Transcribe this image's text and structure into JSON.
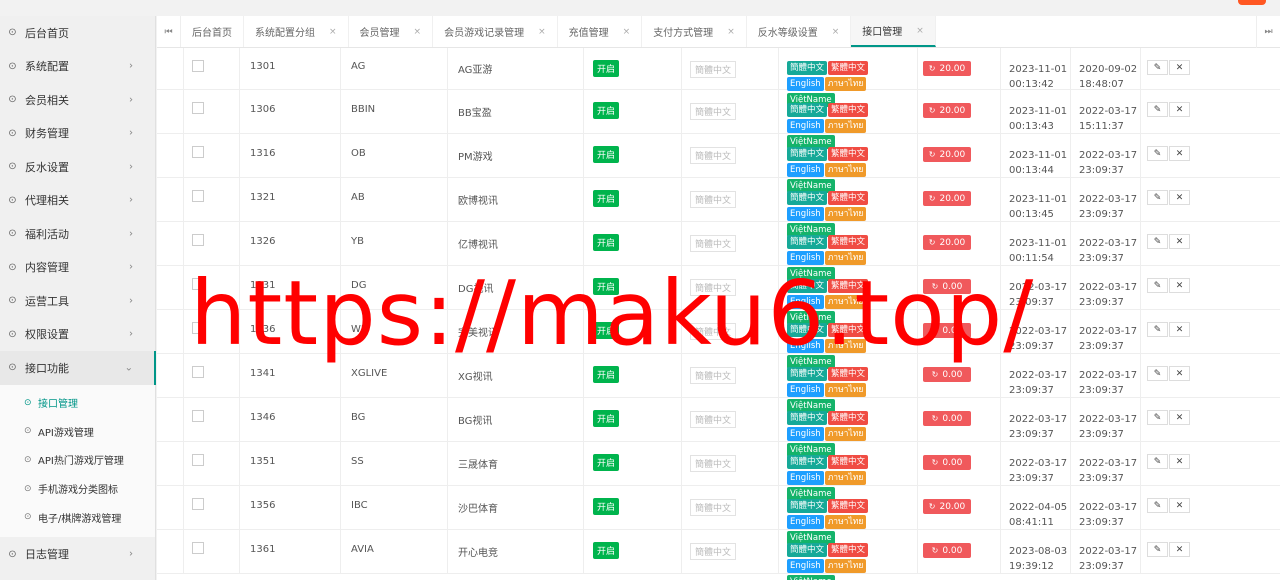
{
  "sidebar": {
    "items": [
      {
        "label": "后台首页",
        "icon": "leaf-icon",
        "has_arrow": false
      },
      {
        "label": "系统配置",
        "icon": "leaf-icon",
        "has_arrow": true
      },
      {
        "label": "会员相关",
        "icon": "leaf-icon",
        "has_arrow": true
      },
      {
        "label": "财务管理",
        "icon": "leaf-icon",
        "has_arrow": true
      },
      {
        "label": "反水设置",
        "icon": "leaf-icon",
        "has_arrow": true
      },
      {
        "label": "代理相关",
        "icon": "leaf-icon",
        "has_arrow": true
      },
      {
        "label": "福利活动",
        "icon": "leaf-icon",
        "has_arrow": true
      },
      {
        "label": "内容管理",
        "icon": "leaf-icon",
        "has_arrow": true
      },
      {
        "label": "运营工具",
        "icon": "leaf-icon",
        "has_arrow": true
      },
      {
        "label": "权限设置",
        "icon": "leaf-icon",
        "has_arrow": true
      },
      {
        "label": "接口功能",
        "icon": "leaf-icon",
        "has_arrow": true,
        "open": true
      }
    ],
    "sub_items": [
      {
        "label": "接口管理",
        "active": true
      },
      {
        "label": "API游戏管理"
      },
      {
        "label": "API热门游戏厅管理"
      },
      {
        "label": "手机游戏分类图标"
      },
      {
        "label": "电子/棋牌游戏管理"
      }
    ],
    "last_item": {
      "label": "日志管理"
    }
  },
  "tabs": {
    "items": [
      {
        "label": "后台首页",
        "closable": false
      },
      {
        "label": "系统配置分组",
        "closable": true
      },
      {
        "label": "会员管理",
        "closable": true
      },
      {
        "label": "会员游戏记录管理",
        "closable": true
      },
      {
        "label": "充值管理",
        "closable": true
      },
      {
        "label": "支付方式管理",
        "closable": true
      },
      {
        "label": "反水等级设置",
        "closable": true
      },
      {
        "label": "接口管理",
        "closable": true,
        "active": true
      }
    ],
    "close_glyph": "×",
    "prev_glyph": "⏮",
    "next_glyph": "⏭"
  },
  "table": {
    "status_label": "开启",
    "lang_simplified": "簡體中文",
    "lang_traditional": "繁體中文",
    "lang_english": "English",
    "lang_thai": "ภาษาไทย",
    "lang_viet": "ViệtName",
    "edit_glyph": "✎",
    "delete_glyph": "✕",
    "refresh_glyph": "↻",
    "rows": [
      {
        "id": "1301",
        "code": "AG",
        "name": "AG亚游",
        "amount": "20.00",
        "created": "2023-11-01",
        "created_time": "00:13:42",
        "updated": "2020-09-02",
        "updated_time": "18:48:07"
      },
      {
        "id": "1306",
        "code": "BBIN",
        "name": "BB宝盈",
        "amount": "20.00",
        "created": "2023-11-01",
        "created_time": "00:13:43",
        "updated": "2022-03-17",
        "updated_time": "15:11:37"
      },
      {
        "id": "1316",
        "code": "OB",
        "name": "PM游戏",
        "amount": "20.00",
        "created": "2023-11-01",
        "created_time": "00:13:44",
        "updated": "2022-03-17",
        "updated_time": "23:09:37"
      },
      {
        "id": "1321",
        "code": "AB",
        "name": "欧博视讯",
        "amount": "20.00",
        "created": "2023-11-01",
        "created_time": "00:13:45",
        "updated": "2022-03-17",
        "updated_time": "23:09:37"
      },
      {
        "id": "1326",
        "code": "YB",
        "name": "亿博视讯",
        "amount": "20.00",
        "created": "2023-11-01",
        "created_time": "00:11:54",
        "updated": "2022-03-17",
        "updated_time": "23:09:37"
      },
      {
        "id": "1331",
        "code": "DG",
        "name": "DG视讯",
        "amount": "0.00",
        "created": "2022-03-17",
        "created_time": "23:09:37",
        "updated": "2022-03-17",
        "updated_time": "23:09:37"
      },
      {
        "id": "1336",
        "code": "WM",
        "name": "完美视讯",
        "amount": "0.00",
        "created": "2022-03-17",
        "created_time": "23:09:37",
        "updated": "2022-03-17",
        "updated_time": "23:09:37"
      },
      {
        "id": "1341",
        "code": "XGLIVE",
        "name": "XG视讯",
        "amount": "0.00",
        "created": "2022-03-17",
        "created_time": "23:09:37",
        "updated": "2022-03-17",
        "updated_time": "23:09:37"
      },
      {
        "id": "1346",
        "code": "BG",
        "name": "BG视讯",
        "amount": "0.00",
        "created": "2022-03-17",
        "created_time": "23:09:37",
        "updated": "2022-03-17",
        "updated_time": "23:09:37"
      },
      {
        "id": "1351",
        "code": "SS",
        "name": "三晟体育",
        "amount": "0.00",
        "created": "2022-03-17",
        "created_time": "23:09:37",
        "updated": "2022-03-17",
        "updated_time": "23:09:37"
      },
      {
        "id": "1356",
        "code": "IBC",
        "name": "沙巴体育",
        "amount": "20.00",
        "created": "2022-04-05",
        "created_time": "08:41:11",
        "updated": "2022-03-17",
        "updated_time": "23:09:37"
      },
      {
        "id": "1361",
        "code": "AVIA",
        "name": "开心电竞",
        "amount": "0.00",
        "created": "2023-08-03",
        "created_time": "19:39:12",
        "updated": "2022-03-17",
        "updated_time": "23:09:37"
      }
    ]
  },
  "watermark": {
    "text": "https://maku6.top/"
  },
  "colors": {
    "accent": "#009688",
    "status_green": "#00b44d",
    "amount_red": "#f0595c",
    "watermark_red": "#ff0000"
  }
}
